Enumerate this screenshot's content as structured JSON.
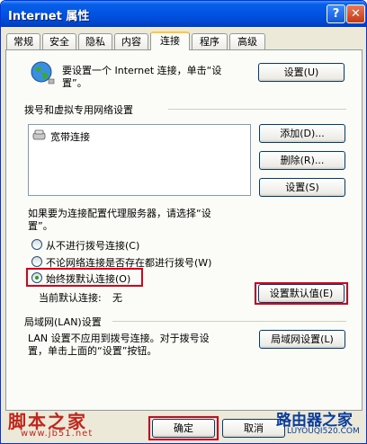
{
  "window": {
    "title": "Internet 属性",
    "help_label": "?",
    "close_label": "✕"
  },
  "tabs": [
    {
      "label": "常规"
    },
    {
      "label": "安全"
    },
    {
      "label": "隐私"
    },
    {
      "label": "内容"
    },
    {
      "label": "连接"
    },
    {
      "label": "程序"
    },
    {
      "label": "高级"
    }
  ],
  "active_tab": "连接",
  "setup": {
    "text_line1": "要设置一个 Internet 连接，单击“设",
    "text_line2": "置”。",
    "button_label": "设置(U)",
    "icon": "globe-network-icon"
  },
  "dialup": {
    "group_title": "拨号和虚拟专用网络设置",
    "connections": [
      {
        "name": "宽带连接",
        "icon": "dialup-connection-icon"
      }
    ],
    "add_label": "添加(D)...",
    "remove_label": "删除(R)...",
    "settings_label": "设置(S)",
    "proxy_note_line1": "如果要为连接配置代理服务器，请选择“设",
    "proxy_note_line2": "置”。",
    "options": [
      {
        "label": "从不进行拨号连接(C)",
        "selected": false
      },
      {
        "label": "不论网络连接是否存在都进行拨号(W)",
        "selected": false
      },
      {
        "label": "始终拨默认连接(O)",
        "selected": true
      }
    ],
    "current_default_label": "当前默认连接:",
    "current_default_value": "无",
    "set_default_label": "设置默认值(E)"
  },
  "lan": {
    "group_title": "局域网(LAN)设置",
    "text_line1": "LAN 设置不应用到拨号连接。对于拨号设",
    "text_line2": "置，单击上面的“设置”按钮。",
    "button_label": "局域网设置(L)"
  },
  "footer": {
    "ok_label": "确定",
    "cancel_label": "取消"
  },
  "watermarks": {
    "left_logo": "脚本之家",
    "left_url": "www.jb51.net",
    "right_logo": "路由器之家",
    "right_url": "LUYOUQI520.COM"
  },
  "colors": {
    "highlight": "#e0001a",
    "titlebar": "#0055e5"
  }
}
